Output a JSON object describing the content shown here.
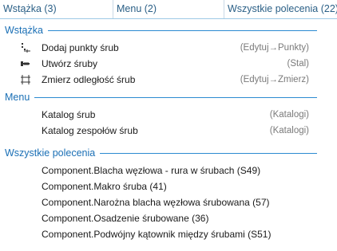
{
  "tabs": [
    {
      "label": "Wstążka (3)"
    },
    {
      "label": "Menu (2)"
    },
    {
      "label": "Wszystkie polecenia (22)"
    }
  ],
  "sections": {
    "ribbon": {
      "title": "Wstążka",
      "items": [
        {
          "label": "Dodaj punkty śrub",
          "category": "(Edytuj→Punkty)",
          "icon": "add-bolt-points-icon"
        },
        {
          "label": "Utwórz śruby",
          "category": "(Stal)",
          "icon": "create-bolts-icon"
        },
        {
          "label": "Zmierz odległość śrub",
          "category": "(Edytuj→Zmierz)",
          "icon": "measure-bolt-distance-icon"
        }
      ]
    },
    "menu": {
      "title": "Menu",
      "items": [
        {
          "label": "Katalog śrub",
          "category": "(Katalogi)"
        },
        {
          "label": "Katalog zespołów śrub",
          "category": "(Katalogi)"
        }
      ]
    },
    "all": {
      "title": "Wszystkie polecenia",
      "items": [
        {
          "label": "Component.Blacha węzłowa - rura w śrubach (S49)"
        },
        {
          "label": "Component.Makro śruba (41)"
        },
        {
          "label": "Component.Narożna blacha węzłowa śrubowana (57)"
        },
        {
          "label": "Component.Osadzenie śrubowane (36)"
        },
        {
          "label": "Component.Podwójny kątownik między śrubami (S51)"
        }
      ]
    }
  },
  "colors": {
    "accent": "#1a6fb5",
    "tab_text": "#2a5f86",
    "category_text": "#7a7a7a"
  }
}
